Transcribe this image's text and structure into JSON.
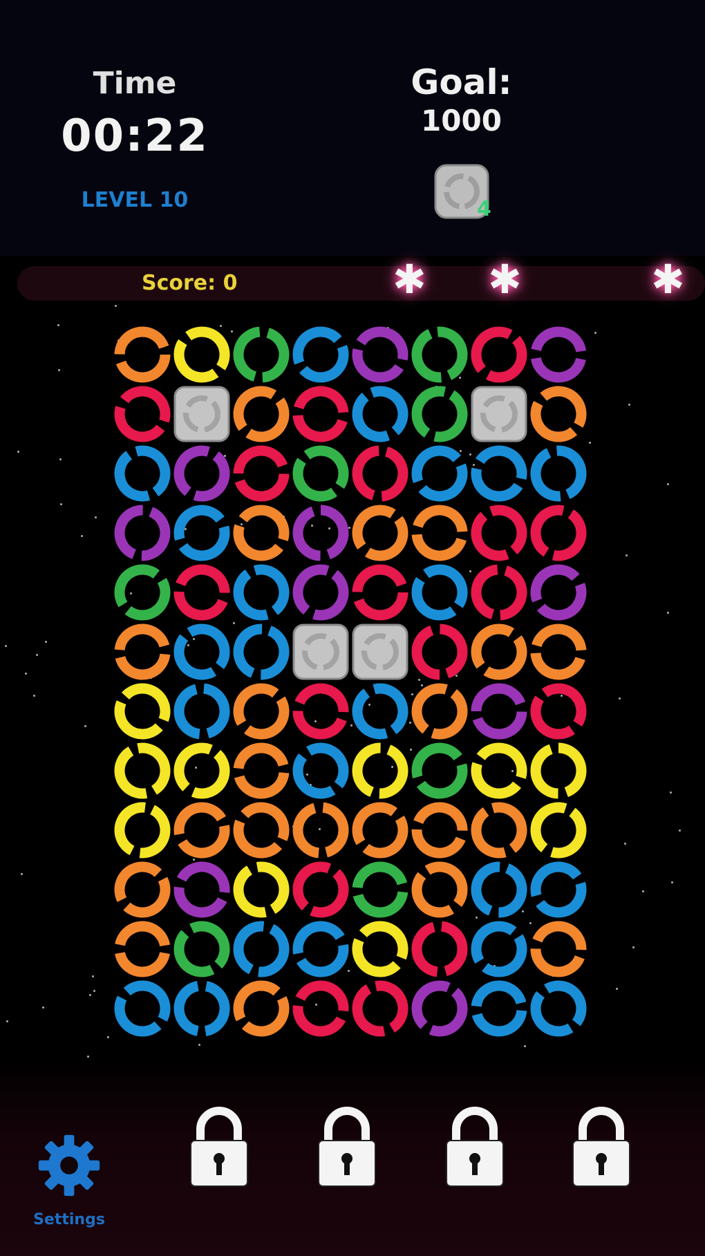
{
  "header": {
    "time_label": "Time",
    "time_value": "00:22",
    "level_label": "LEVEL 10",
    "goal_label": "Goal:",
    "goal_value": "1000",
    "goal_target_icon": "stone-block-icon",
    "goal_target_count": "4"
  },
  "score": {
    "label": "Score:  0",
    "stars": 3,
    "stars_earned": 0
  },
  "board": {
    "rows": [
      [
        "orange",
        "yellow",
        "green",
        "blue",
        "purple",
        "green",
        "red",
        "purple"
      ],
      [
        "red",
        "stone",
        "orange",
        "red",
        "blue",
        "green",
        "stone",
        "orange"
      ],
      [
        "blue",
        "purple",
        "red",
        "green",
        "red",
        "blue",
        "blue",
        "blue"
      ],
      [
        "purple",
        "blue",
        "orange",
        "purple",
        "orange",
        "orange",
        "red",
        "red"
      ],
      [
        "green",
        "red",
        "blue",
        "purple",
        "red",
        "blue",
        "red",
        "purple"
      ],
      [
        "orange",
        "blue",
        "blue",
        "stone",
        "stone",
        "red",
        "orange",
        "orange"
      ],
      [
        "yellow",
        "blue",
        "orange",
        "red",
        "blue",
        "orange",
        "purple",
        "red"
      ],
      [
        "yellow",
        "yellow",
        "orange",
        "blue",
        "yellow",
        "green",
        "yellow",
        "yellow"
      ],
      [
        "yellow",
        "orange",
        "orange",
        "orange",
        "orange",
        "orange",
        "orange",
        "yellow"
      ],
      [
        "orange",
        "purple",
        "yellow",
        "red",
        "green",
        "orange",
        "blue",
        "blue"
      ],
      [
        "orange",
        "green",
        "blue",
        "blue",
        "yellow",
        "red",
        "blue",
        "orange"
      ],
      [
        "blue",
        "blue",
        "orange",
        "red",
        "red",
        "purple",
        "blue",
        "blue"
      ]
    ]
  },
  "colors": {
    "orange": "#f2872e",
    "yellow": "#f4e626",
    "green": "#34b34a",
    "blue": "#1a8fd8",
    "purple": "#9a35b8",
    "red": "#e8194c",
    "stone": "#c4c4c4"
  },
  "footer": {
    "settings_label": "Settings",
    "settings_icon": "gear-icon",
    "locked_boosters": [
      "lock-icon",
      "lock-icon",
      "lock-icon",
      "lock-icon"
    ]
  }
}
